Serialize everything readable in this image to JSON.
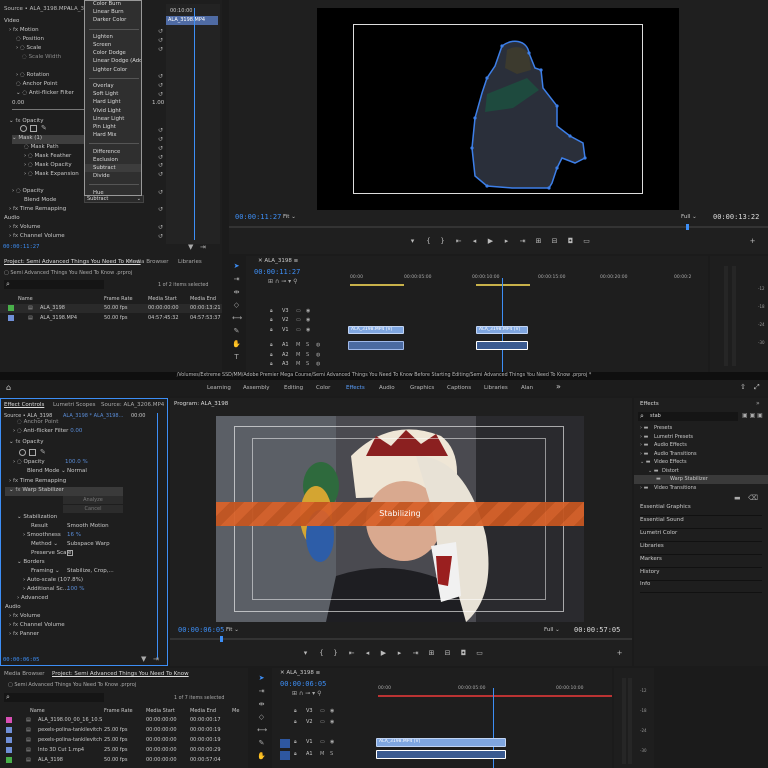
{
  "top": {
    "source_tab": "Source • ALA_3198.MP4",
    "source_tab2": "ALA_3…",
    "ec_time1": "00:10:00",
    "ec_clip": "ALA_3198.MP4",
    "ec_rows": [
      {
        "label": "Video",
        "val": ""
      },
      {
        "label": "Motion",
        "val": ""
      },
      {
        "label": "Position",
        "val": ""
      },
      {
        "label": "Scale",
        "val": ""
      },
      {
        "label": "Scale Width",
        "val": ""
      },
      {
        "label": "",
        "val": ""
      },
      {
        "label": "Rotation",
        "val": ""
      },
      {
        "label": "Anchor Point",
        "val": ""
      },
      {
        "label": "Anti-flicker Filter",
        "val": ""
      }
    ],
    "aff_left": "0.00",
    "aff_right": "1.00",
    "opacity_label": "Opacity",
    "mask_label": "Mask (1)",
    "mask_rows": [
      "Mask Path",
      "Mask Feather",
      "Mask Opacity",
      "Mask Expansion"
    ],
    "opacity2": "Opacity",
    "blend_mode": "Blend Mode",
    "blend_value": "Subtract",
    "time_remap": "Time Remapping",
    "audio": "Audio",
    "volume": "Volume",
    "channel_volume": "Channel Volume",
    "ec_timecode": "00:00:11:27",
    "blend_menu": [
      "Color Burn",
      "Linear Burn",
      "Darker Color",
      "",
      "Lighten",
      "Screen",
      "Color Dodge",
      "Linear Dodge (Add)",
      "Lighter Color",
      "",
      "Overlay",
      "Soft Light",
      "Hard Light",
      "Vivid Light",
      "Linear Light",
      "Pin Light",
      "Hard Mix",
      "",
      "Difference",
      "Exclusion",
      "Subtract",
      "Divide",
      "",
      "Hue"
    ],
    "program_timecode": "00:00:11:27",
    "program_fit": "Fit",
    "program_quality": "Full",
    "program_duration": "00:00:13:22",
    "project_tab": "Project: Semi Advanced Things You Need To Know",
    "media_browser": "Media Browser",
    "libraries": "Libraries",
    "project_file": "Semi Advanced Things You Need To Know .prproj",
    "items_selected": "1 of 2 items selected",
    "cols": [
      "Name",
      "Frame Rate",
      "Media Start",
      "Media End"
    ],
    "items": [
      {
        "name": "ALA_3198",
        "fps": "50.00 fps",
        "start": "00:00:00:00",
        "end": "00:00:13:21",
        "color": "#49b04a"
      },
      {
        "name": "ALA_3198.MP4",
        "fps": "50.00 fps",
        "start": "04:57:45:32",
        "end": "04:57:53:37",
        "color": "#6f8fd6"
      }
    ],
    "seq_name": "ALA_3198",
    "seq_timecode": "00:00:11:27",
    "ruler": [
      "00:00",
      "00:00:05:00",
      "00:00:10:00",
      "00:00:15:00",
      "00:00:20:00",
      "00:00:2"
    ],
    "tracks": [
      "V3",
      "V2",
      "V1",
      "A1",
      "A2",
      "A3"
    ],
    "clip1": "ALA_3198.MP4 [V]",
    "clip2": "ALA_3198.MP4 [V]"
  },
  "path_bar": "/Volumes/Extreme SSD/MM/Adobe Premier Mega Course/Semi Advanced Things You Need To Know Before Starting Editing/Semi Advanced Things You Need To Know .prproj *",
  "workspaces": [
    "Learning",
    "Assembly",
    "Editing",
    "Color",
    "Effects",
    "Audio",
    "Graphics",
    "Captions",
    "Libraries",
    "Alan"
  ],
  "bottom": {
    "ec_tab": "Effect Controls",
    "lumetri": "Lumetri Scopes",
    "source": "Source: ALA_3206.MP4",
    "ec_src": "Source • ALA_3198",
    "ec_seq": "ALA_3198 * ALA_3198...",
    "ec_time": "00:00",
    "ec_anchor": "Anchor Point",
    "aff": "Anti-flicker Filter",
    "aff_val": "0.00",
    "opacity": "Opacity",
    "opacity2": "Opacity",
    "opacity_val": "100.0 %",
    "blend": "Blend Mode",
    "blend_val": "Normal",
    "time_remap": "Time Remapping",
    "warp": "Warp Stabilizer",
    "analyze": "Analyze",
    "cancel": "Cancel",
    "stabilization": "Stabilization",
    "result": "Result",
    "result_val": "Smooth Motion",
    "smoothness": "Smoothness",
    "smoothness_val": "16 %",
    "method": "Method",
    "method_val": "Subspace Warp",
    "preserve": "Preserve Scale",
    "borders": "Borders",
    "framing": "Framing",
    "framing_val": "Stabilize, Crop,...",
    "autoscale": "Auto-scale (107.8%)",
    "addl": "Additional Sc...",
    "addl_val": "100 %",
    "advanced": "Advanced",
    "audio": "Audio",
    "volume": "Volume",
    "channel_volume": "Channel Volume",
    "panner": "Panner",
    "ec_timecode": "00:00:06:05",
    "program_tab": "Program: ALA_3198",
    "stabilizing": "Stabilizing",
    "program_timecode": "00:00:06:05",
    "program_fit": "Fit",
    "program_quality": "Full",
    "program_duration": "00:00:57:05",
    "effects_tab": "Effects",
    "search_value": "stab",
    "effects_tree": [
      {
        "label": "Presets",
        "indent": 0
      },
      {
        "label": "Lumetri Presets",
        "indent": 0
      },
      {
        "label": "Audio Effects",
        "indent": 0
      },
      {
        "label": "Audio Transitions",
        "indent": 0
      },
      {
        "label": "Video Effects",
        "indent": 0
      },
      {
        "label": "Distort",
        "indent": 1
      },
      {
        "label": "Warp Stabilizer",
        "indent": 2
      },
      {
        "label": "Video Transitions",
        "indent": 0
      }
    ],
    "effects_panels": [
      "Essential Graphics",
      "Essential Sound",
      "Lumetri Color",
      "Libraries",
      "Markers",
      "History",
      "Info"
    ],
    "media_browser": "Media Browser",
    "project_tab": "Project: Semi Advanced Things You Need To Know",
    "project_file": "Semi Advanced Things You Need To Know .prproj",
    "items_selected": "1 of 7 items selected",
    "cols": [
      "Name",
      "Frame Rate",
      "Media Start",
      "Media End",
      "Me"
    ],
    "items": [
      {
        "name": "ALA_3198.00_00_16_10.Still",
        "fps": "",
        "start": "00:00:00:00",
        "end": "00:00:00:17",
        "color": "#d84fb5"
      },
      {
        "name": "pexels-polina-tankilevitch-6",
        "fps": "25.00 fps",
        "start": "00:00:00:00",
        "end": "00:00:00:19",
        "color": "#6f8fd6"
      },
      {
        "name": "pexels-polina-tankilevitch-6",
        "fps": "25.00 fps",
        "start": "00:00:00:00",
        "end": "00:00:00:19",
        "color": "#6f8fd6"
      },
      {
        "name": "Into 3D Cut 1.mp4",
        "fps": "25.00 fps",
        "start": "00:00:00:00",
        "end": "00:00:00:29",
        "color": "#6f8fd6"
      },
      {
        "name": "ALA_3198",
        "fps": "50.00 fps",
        "start": "00:00:00:00",
        "end": "00:00:57:04",
        "color": "#49b04a"
      }
    ],
    "seq_name": "ALA_3198",
    "seq_timecode": "00:00:06:05",
    "ruler": [
      "00:00",
      "00:00:05:00",
      "00:00:10:00"
    ],
    "tracks": [
      "V3",
      "V2",
      "V1",
      "A1"
    ],
    "clip": "ALA_3198.MP4 [V]"
  },
  "colors": {
    "accent": "#3d8ef5",
    "clip_blue": "#7fa6e0",
    "orange": "#d8622a",
    "panel": "#1e1e1e"
  }
}
